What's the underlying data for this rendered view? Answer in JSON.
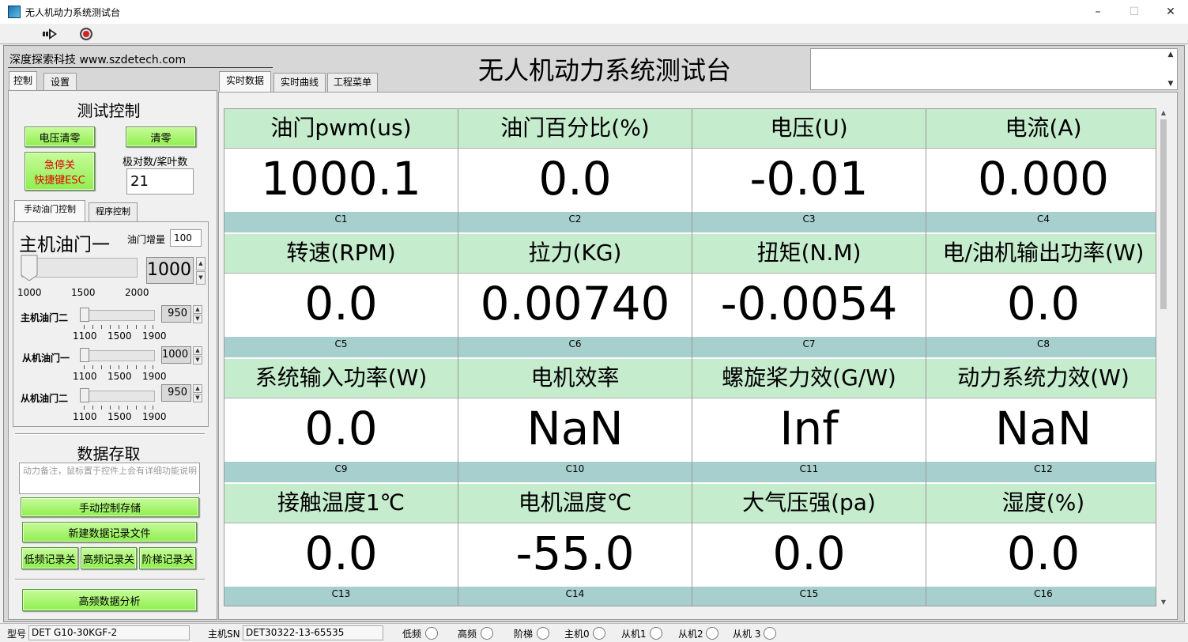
{
  "window": {
    "title": "无人机动力系统测试台",
    "minimize": "–",
    "maximize": "☐",
    "close": "✕"
  },
  "header": {
    "company": "深度探索科技 www.szdetech.com",
    "title": "无人机动力系统测试台"
  },
  "left_tabs": [
    "控制",
    "设置"
  ],
  "right_tabs": [
    "实时数据",
    "实时曲线",
    "工程菜单"
  ],
  "control": {
    "section_title": "测试控制",
    "zero_voltage_label": "电压清零",
    "zero_label": "清零",
    "estop_line1": "急停关",
    "estop_line2": "快捷键ESC",
    "pole_label": "极对数/桨叶数",
    "pole_value": "21"
  },
  "throttle_tabs": [
    "手动油门控制",
    "程序控制"
  ],
  "throttle": {
    "main1_label": "主机油门一",
    "increment_label": "油门增量",
    "increment_value": "100",
    "main1_value": "1000",
    "main1_ticks": [
      "1000",
      "1500",
      "2000"
    ],
    "main2_label": "主机油门二",
    "main2_value": "950",
    "slave1_label": "从机油门一",
    "slave1_value": "1000",
    "slave2_label": "从机油门二",
    "slave2_value": "950",
    "small_ticks": [
      "1100",
      "1500",
      "1900"
    ]
  },
  "storage": {
    "section_title": "数据存取",
    "note_placeholder": "动力备注，鼠标置于控件上会有详细功能说明",
    "manual_save": "手动控制存储",
    "new_file": "新建数据记录文件",
    "low_freq": "低频记录关",
    "high_freq": "高频记录关",
    "step": "阶梯记录关",
    "analysis": "高频数据分析"
  },
  "cells": [
    {
      "label": "油门pwm(us)",
      "value": "1000.1",
      "code": "C1"
    },
    {
      "label": "油门百分比(%)",
      "value": "0.0",
      "code": "C2"
    },
    {
      "label": "电压(U)",
      "value": "-0.01",
      "code": "C3"
    },
    {
      "label": "电流(A)",
      "value": "0.000",
      "code": "C4"
    },
    {
      "label": "转速(RPM)",
      "value": "0.0",
      "code": "C5"
    },
    {
      "label": "拉力(KG)",
      "value": "0.00740",
      "code": "C6"
    },
    {
      "label": "扭矩(N.M)",
      "value": "-0.0054",
      "code": "C7"
    },
    {
      "label": "电/油机输出功率(W)",
      "value": "0.0",
      "code": "C8"
    },
    {
      "label": "系统输入功率(W)",
      "value": "0.0",
      "code": "C9"
    },
    {
      "label": "电机效率",
      "value": "NaN",
      "code": "C10"
    },
    {
      "label": "螺旋桨力效(G/W)",
      "value": "Inf",
      "code": "C11"
    },
    {
      "label": "动力系统力效(W)",
      "value": "NaN",
      "code": "C12"
    },
    {
      "label": "接触温度1℃",
      "value": "0.0",
      "code": "C13"
    },
    {
      "label": "电机温度℃",
      "value": "-55.0",
      "code": "C14"
    },
    {
      "label": "大气压强(pa)",
      "value": "0.0",
      "code": "C15"
    },
    {
      "label": "湿度(%)",
      "value": "0.0",
      "code": "C16"
    }
  ],
  "status": {
    "model_label": "型号",
    "model_value": "DET G10-30KGF-2",
    "sn_label": "主机SN",
    "sn_value": "DET30322-13-65535",
    "indicators": [
      "低频",
      "高频",
      "阶梯",
      "主机0",
      "从机1",
      "从机2",
      "从机 3"
    ]
  },
  "colors": {
    "cell_header": "#c6ecce",
    "cell_code": "#a7cfcd",
    "button_green": "#8fef4e",
    "estop_text": "#e00000"
  }
}
